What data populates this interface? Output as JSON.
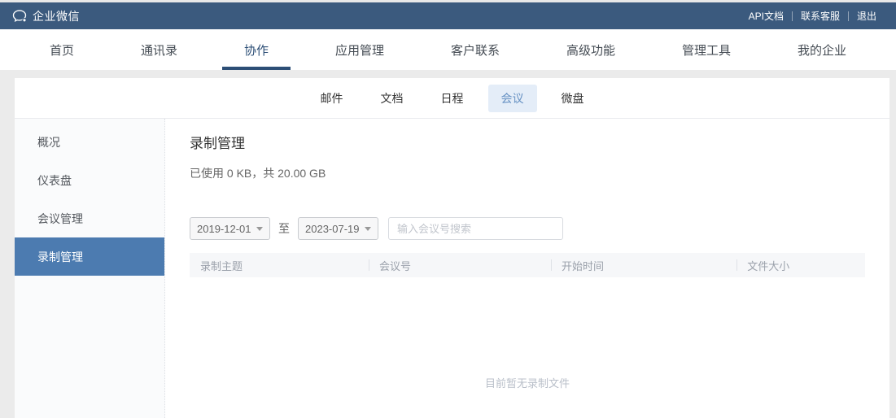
{
  "topbar": {
    "brand": "企业微信",
    "links": [
      {
        "label": "API文档"
      },
      {
        "label": "联系客服"
      },
      {
        "label": "退出"
      }
    ]
  },
  "nav": {
    "items": [
      {
        "label": "首页",
        "active": false
      },
      {
        "label": "通讯录",
        "active": false
      },
      {
        "label": "协作",
        "active": true
      },
      {
        "label": "应用管理",
        "active": false
      },
      {
        "label": "客户联系",
        "active": false
      },
      {
        "label": "高级功能",
        "active": false
      },
      {
        "label": "管理工具",
        "active": false
      },
      {
        "label": "我的企业",
        "active": false
      }
    ]
  },
  "subnav": {
    "tabs": [
      {
        "label": "邮件",
        "active": false
      },
      {
        "label": "文档",
        "active": false
      },
      {
        "label": "日程",
        "active": false
      },
      {
        "label": "会议",
        "active": true
      },
      {
        "label": "微盘",
        "active": false
      }
    ]
  },
  "sidebar": {
    "items": [
      {
        "label": "概况",
        "active": false
      },
      {
        "label": "仪表盘",
        "active": false
      },
      {
        "label": "会议管理",
        "active": false
      },
      {
        "label": "录制管理",
        "active": true
      }
    ]
  },
  "main": {
    "title": "录制管理",
    "usage": "已使用 0 KB，共 20.00 GB",
    "filters": {
      "start_date": "2019-12-01",
      "range_separator": "至",
      "end_date": "2023-07-19",
      "search_placeholder": "输入会议号搜索"
    },
    "table": {
      "columns": [
        "录制主题",
        "会议号",
        "开始时间",
        "文件大小"
      ],
      "rows": [],
      "empty_text": "目前暂无录制文件"
    }
  },
  "colors": {
    "topbar_bg": "#3b5a7e",
    "nav_active": "#2c4e76",
    "subnav_active_bg": "#e4edf8",
    "subnav_active_text": "#6691c3",
    "sidebar_active_bg": "#4c7bb0",
    "page_bg": "#ebebeb",
    "table_header_bg": "#f6f7f9"
  }
}
